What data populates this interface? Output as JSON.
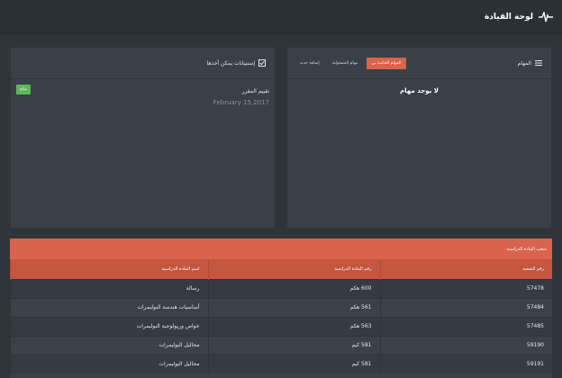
{
  "header": {
    "title": "لوحة القيادة",
    "icon": "pulse-icon"
  },
  "tasks": {
    "title": "المهام",
    "tabs": [
      {
        "label": "المهام الخاصة بي",
        "active": true
      },
      {
        "label": "مهام المسئولية",
        "active": false
      },
      {
        "label": "إضافة جديد",
        "active": false
      }
    ],
    "empty_message": "لا يوجد مهام"
  },
  "actions": {
    "title": "إستبيانات يمكن أخذها",
    "item": {
      "title": "تقييم المقرر",
      "date": "February 15,2017",
      "badge": "متاح"
    }
  },
  "courses": {
    "caption": "شعب المادة الدراسية",
    "columns": [
      "رقم الشعبة",
      "رقم المادة الدراسية",
      "اسم المادة الدراسية"
    ],
    "rows": [
      [
        "57478",
        "600 هكم",
        "رسالة"
      ],
      [
        "57484",
        "561 هكم",
        "أساسيات هندسة البوليمرات"
      ],
      [
        "57485",
        "563 هكم",
        "خواص وريولوجية البوليمرات"
      ],
      [
        "59190",
        "581 كيم",
        "محاليل البوليمرات"
      ],
      [
        "59191",
        "581 كيم",
        "محاليل البوليمرات"
      ]
    ]
  },
  "colors": {
    "accent": "#d9634b",
    "badge": "#5cb85c",
    "background": "#2f343b"
  }
}
